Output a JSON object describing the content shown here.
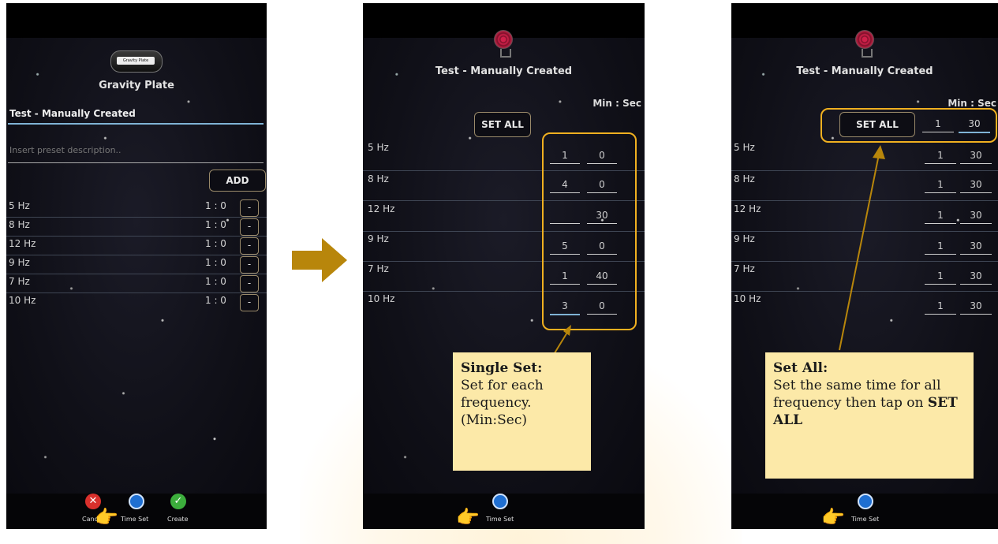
{
  "screen1": {
    "device_name": "Gravity Plate",
    "device_badge": "Gravity Plate",
    "preset_name": "Test - Manually Created",
    "description_placeholder": "Insert preset description..",
    "add_label": "ADD",
    "rows": [
      {
        "freq": "5 Hz",
        "time": "1 : 0",
        "remove_label": "-"
      },
      {
        "freq": "8 Hz",
        "time": "1 : 0",
        "remove_label": "-"
      },
      {
        "freq": "12 Hz",
        "time": "1 : 0",
        "remove_label": "-"
      },
      {
        "freq": "9 Hz",
        "time": "1 : 0",
        "remove_label": "-"
      },
      {
        "freq": "7 Hz",
        "time": "1 : 0",
        "remove_label": "-"
      },
      {
        "freq": "10 Hz",
        "time": "1 : 0",
        "remove_label": "-"
      }
    ],
    "bottom": {
      "cancel": "Cancel",
      "time_set": "Time Set",
      "create": "Create"
    }
  },
  "screen2": {
    "title": "Test - Manually Created",
    "min_sec_label": "Min : Sec",
    "set_all_label": "SET ALL",
    "rows": [
      {
        "freq": "5 Hz",
        "min": "1",
        "sec": "0"
      },
      {
        "freq": "8 Hz",
        "min": "4",
        "sec": "0"
      },
      {
        "freq": "12 Hz",
        "min": "",
        "sec": "30"
      },
      {
        "freq": "9 Hz",
        "min": "5",
        "sec": "0"
      },
      {
        "freq": "7 Hz",
        "min": "1",
        "sec": "40"
      },
      {
        "freq": "10 Hz",
        "min": "3",
        "sec": "0"
      }
    ],
    "time_set_label": "Time Set",
    "note_heading": "Single Set:",
    "note_body": "Set for each frequency. (Min:Sec)"
  },
  "screen3": {
    "title": "Test - Manually Created",
    "min_sec_label": "Min : Sec",
    "set_all_label": "SET ALL",
    "set_all_min": "1",
    "set_all_sec": "30",
    "rows": [
      {
        "freq": "5 Hz",
        "min": "1",
        "sec": "30"
      },
      {
        "freq": "8 Hz",
        "min": "1",
        "sec": "30"
      },
      {
        "freq": "12 Hz",
        "min": "1",
        "sec": "30"
      },
      {
        "freq": "9 Hz",
        "min": "1",
        "sec": "30"
      },
      {
        "freq": "7 Hz",
        "min": "1",
        "sec": "30"
      },
      {
        "freq": "10 Hz",
        "min": "1",
        "sec": "30"
      }
    ],
    "time_set_label": "Time Set",
    "note_heading": "Set All:",
    "note_body": "Set the same time for all frequency then tap on",
    "note_emphasis": "SET ALL"
  },
  "colors": {
    "callout": "#f0b020",
    "note_bg": "#fce9a8",
    "arrow": "#b8860b",
    "accent_line": "#7fb3d5"
  },
  "icons": {
    "transition_arrow": "right-arrow-icon",
    "pointer": "pointing-hand-icon"
  }
}
